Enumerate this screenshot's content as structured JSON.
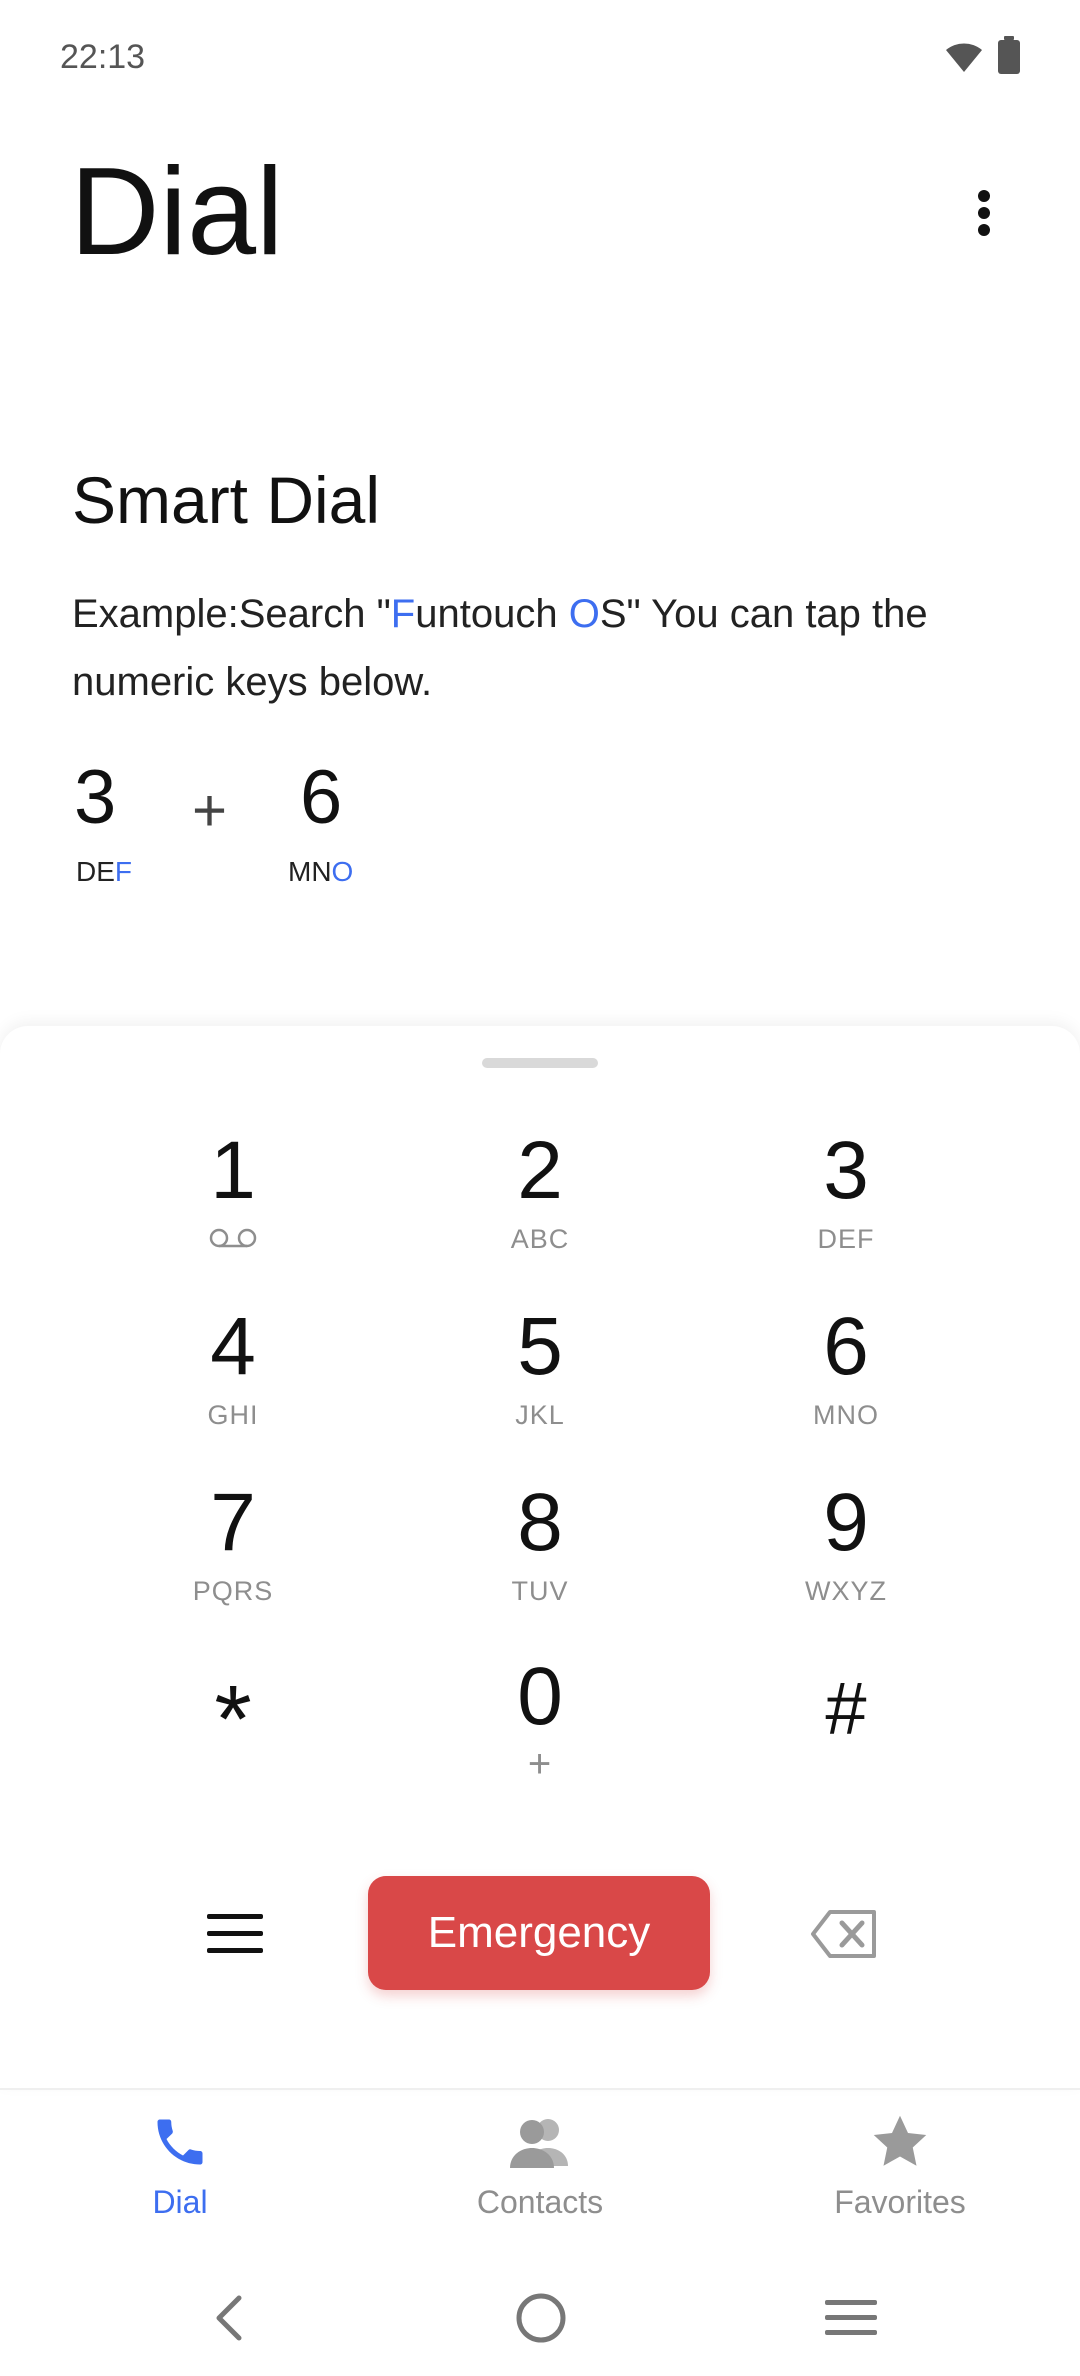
{
  "status_bar": {
    "time": "22:13"
  },
  "header": {
    "title": "Dial"
  },
  "smart_dial": {
    "title": "Smart Dial",
    "desc_part1": "Example:Search \"",
    "desc_hl1": "F",
    "desc_part2": "untouch ",
    "desc_hl2": "O",
    "desc_part3": "S\" You can tap the numeric keys below.",
    "example_digit_1": "3",
    "example_letters_1_plain": "DE",
    "example_letters_1_hl": "F",
    "example_plus": "+",
    "example_digit_2": "6",
    "example_letters_2_plain": "MN",
    "example_letters_2_hl": "O"
  },
  "keypad": {
    "keys": [
      {
        "digit": "1",
        "sub": ""
      },
      {
        "digit": "2",
        "sub": "ABC"
      },
      {
        "digit": "3",
        "sub": "DEF"
      },
      {
        "digit": "4",
        "sub": "GHI"
      },
      {
        "digit": "5",
        "sub": "JKL"
      },
      {
        "digit": "6",
        "sub": "MNO"
      },
      {
        "digit": "7",
        "sub": "PQRS"
      },
      {
        "digit": "8",
        "sub": "TUV"
      },
      {
        "digit": "9",
        "sub": "WXYZ"
      },
      {
        "digit": "*",
        "sub": ""
      },
      {
        "digit": "0",
        "sub": "+"
      },
      {
        "digit": "#",
        "sub": ""
      }
    ]
  },
  "actions": {
    "emergency_label": "Emergency"
  },
  "bottom_nav": {
    "items": [
      {
        "label": "Dial",
        "active": true
      },
      {
        "label": "Contacts",
        "active": false
      },
      {
        "label": "Favorites",
        "active": false
      }
    ]
  },
  "colors": {
    "accent": "#3d6ef0",
    "emergency": "#d94848",
    "inactive_icon": "#9a9a9a"
  }
}
